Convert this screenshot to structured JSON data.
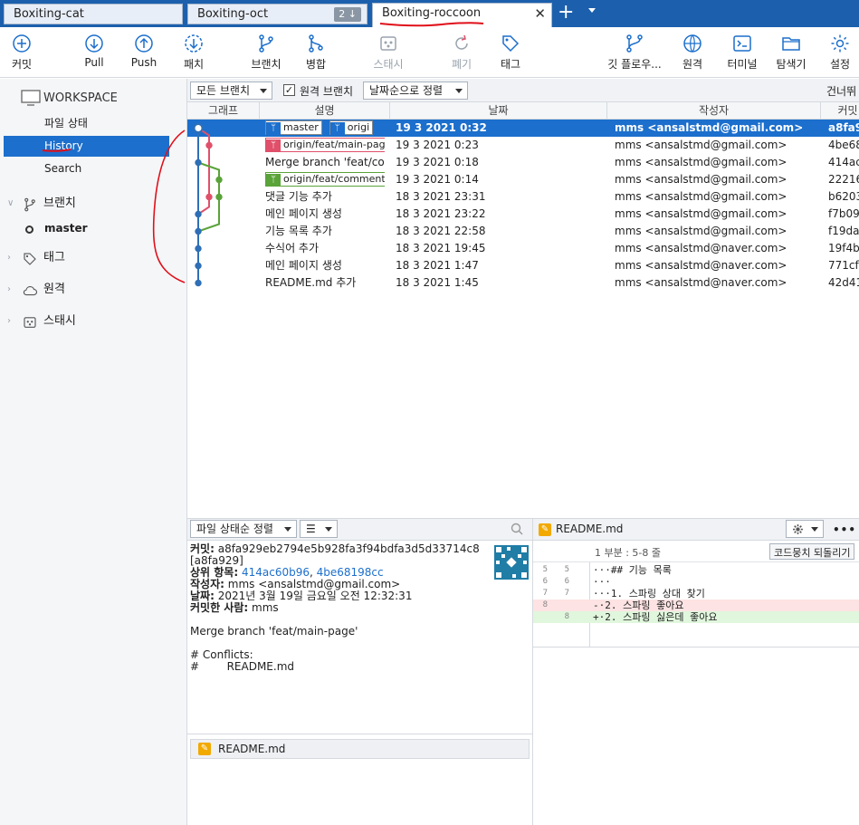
{
  "tabs": [
    {
      "label": "Boxiting-cat"
    },
    {
      "label": "Boxiting-oct",
      "badge": "2 ↓"
    },
    {
      "label": "Boxiting-roccoon",
      "close": "✕"
    }
  ],
  "tab_plus": "+",
  "toolbar": {
    "commit": "커밋",
    "pull": "Pull",
    "push": "Push",
    "fetch": "패치",
    "branch": "브랜치",
    "merge": "병합",
    "stash": "스태시",
    "discard": "폐기",
    "tag": "태그",
    "gitflow": "깃 플로우...",
    "remote": "원격",
    "terminal": "터미널",
    "explorer": "탐색기",
    "settings": "설정"
  },
  "sidebar": {
    "workspace": "WORKSPACE",
    "items": [
      {
        "label": "파일 상태"
      },
      {
        "label": "History"
      },
      {
        "label": "Search"
      }
    ],
    "branches_label": "브랜치",
    "branch_master": "master",
    "tags_label": "태그",
    "remotes_label": "원격",
    "stash_label": "스태시"
  },
  "filter": {
    "branches": "모든 브랜치",
    "remote_branches": "원격 브랜치",
    "sort": "날짜순으로 정렬",
    "jump": "건너뛰"
  },
  "table": {
    "headers": [
      "그래프",
      "설명",
      "날짜",
      "작성자",
      "커밋"
    ],
    "rows": [
      {
        "desc": "",
        "refs": [
          "master",
          "origi"
        ],
        "date": "19 3 2021 0:32",
        "author": "mms <ansalstmd@gmail.com>",
        "hash": "a8fa9"
      },
      {
        "desc": "",
        "refs": [
          "origin/feat/main-page"
        ],
        "date": "19 3 2021 0:23",
        "author": "mms <ansalstmd@gmail.com>",
        "hash": "4be68"
      },
      {
        "desc": "Merge branch 'feat/com",
        "refs": [],
        "date": "19 3 2021 0:18",
        "author": "mms <ansalstmd@gmail.com>",
        "hash": "414ac"
      },
      {
        "desc": "",
        "refs": [
          "origin/feat/comment"
        ],
        "date": "19 3 2021 0:14",
        "author": "mms <ansalstmd@gmail.com>",
        "hash": "22216"
      },
      {
        "desc": "댓글 기능 추가",
        "refs": [],
        "date": "18 3 2021 23:31",
        "author": "mms <ansalstmd@gmail.com>",
        "hash": "b6203"
      },
      {
        "desc": "메인 페이지 생성",
        "refs": [],
        "date": "18 3 2021 23:22",
        "author": "mms <ansalstmd@gmail.com>",
        "hash": "f7b09"
      },
      {
        "desc": "기능 목록 추가",
        "refs": [],
        "date": "18 3 2021 22:58",
        "author": "mms <ansalstmd@gmail.com>",
        "hash": "f19da"
      },
      {
        "desc": "수식어 추가",
        "refs": [],
        "date": "18 3 2021 19:45",
        "author": "mms <ansalstmd@naver.com>",
        "hash": "19f4b"
      },
      {
        "desc": "메인 페이지 생성",
        "refs": [],
        "date": "18 3 2021 1:47",
        "author": "mms <ansalstmd@naver.com>",
        "hash": "771cf"
      },
      {
        "desc": "README.md 추가",
        "refs": [],
        "date": "18 3 2021 1:45",
        "author": "mms <ansalstmd@naver.com>",
        "hash": "42d41"
      }
    ]
  },
  "files_toolbar": {
    "sort": "파일 상태순 정렬",
    "view": "☰"
  },
  "commit_detail": {
    "commit_label": "커밋:",
    "commit_hash": "a8fa929eb2794e5b928fa3f94bdfa3d5d33714c8",
    "short_hash": "[a8fa929]",
    "parents_label": "상위 항목:",
    "parent1": "414ac60b96",
    "parent_sep": ", ",
    "parent2": "4be68198cc",
    "author_label": "작성자:",
    "author": "mms <ansalstmd@gmail.com>",
    "date_label": "날짜:",
    "date": "2021년 3월 19일 금요일 오전 12:32:31",
    "committer_label": "커밋한 사람:",
    "committer": "mms",
    "message": "Merge branch 'feat/main-page'",
    "conflicts": "# Conflicts:",
    "conflict_file": "#        README.md"
  },
  "file_list": [
    {
      "name": "README.md"
    }
  ],
  "diff": {
    "file": "README.md",
    "hunk": "1 부분 : 5-8 줄",
    "revert": "코드뭉치 되돌리기",
    "more": "•••",
    "lines": [
      {
        "old": "5",
        "new": "5",
        "text": "···## 기능 목록",
        "type": "ctx"
      },
      {
        "old": "6",
        "new": "6",
        "text": "···",
        "type": "ctx"
      },
      {
        "old": "7",
        "new": "7",
        "text": "···1. 스파링 상대 찾기",
        "type": "ctx"
      },
      {
        "old": "8",
        "new": "",
        "text": "-·2. 스파링 좋아요",
        "type": "del"
      },
      {
        "old": "",
        "new": "8",
        "text": "+·2. 스파링 싫은데 좋아요",
        "type": "add"
      }
    ]
  },
  "colors": {
    "accent": "#1c6fcc",
    "tabbar": "#1c60ad",
    "graph_blue": "#2f6fb5",
    "graph_pink": "#e0506a",
    "graph_green": "#5aa33a",
    "annotation_red": "#e0101a"
  }
}
